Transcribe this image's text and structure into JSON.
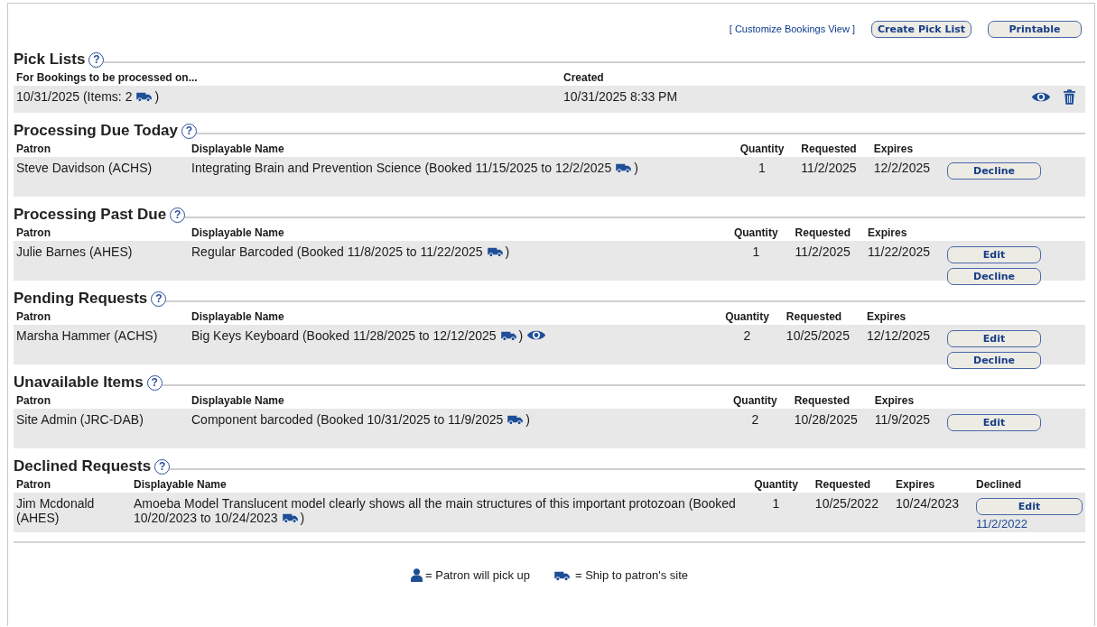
{
  "toolbar": {
    "link": "[ Customize Bookings View ]",
    "buttons": [
      "Create Pick List",
      "Printable"
    ]
  },
  "pick_lists": {
    "title": "Pick Lists",
    "help": "?",
    "columns": [
      "For Bookings to be processed on...",
      "Created"
    ],
    "rows": [
      {
        "date": "10/31/2025 (Items: 2",
        "ship": true,
        "close": ")",
        "created": "10/31/2025 8:33 PM",
        "view": true,
        "delete": true
      }
    ]
  },
  "sections": [
    {
      "title": "Processing Due Today",
      "help": "?",
      "columns": [
        "Patron",
        "Displayable Name",
        "Quantity",
        "Requested",
        "Expires"
      ],
      "rows": [
        {
          "patron": "Steve Davidson (ACHS)",
          "name": [
            "Integrating Brain and Prevention Science (Booked 11/15/2025 to 12/2/2025"
          ],
          "ship": true,
          "close": ")",
          "preview": false,
          "quantity": "1",
          "requested": "11/2/2025",
          "expires": "12/2/2025",
          "actions": [
            "Decline"
          ]
        }
      ]
    },
    {
      "title": "Processing Past Due",
      "help": "?",
      "columns": [
        "Patron",
        "Displayable Name",
        "Quantity",
        "Requested",
        "Expires"
      ],
      "rows": [
        {
          "patron": "Julie Barnes (AHES)",
          "name": [
            "Regular Barcoded (Booked 11/8/2025 to 11/22/2025"
          ],
          "ship": true,
          "close": ")",
          "preview": false,
          "quantity": "1",
          "requested": "11/2/2025",
          "expires": "11/22/2025",
          "actions": [
            "Edit",
            "Decline"
          ]
        }
      ]
    },
    {
      "title": "Pending Requests",
      "help": "?",
      "columns": [
        "Patron",
        "Displayable Name",
        "Quantity",
        "Requested",
        "Expires"
      ],
      "rows": [
        {
          "patron": "Marsha Hammer (ACHS)",
          "name": [
            "Big Keys Keyboard (Booked 11/28/2025 to 12/12/2025"
          ],
          "ship": true,
          "close": ")",
          "preview": true,
          "quantity": "2",
          "requested": "10/25/2025",
          "expires": "12/12/2025",
          "actions": [
            "Edit",
            "Decline"
          ]
        }
      ]
    },
    {
      "title": "Unavailable Items",
      "help": "?",
      "columns": [
        "Patron",
        "Displayable Name",
        "Quantity",
        "Requested",
        "Expires"
      ],
      "rows": [
        {
          "patron": "Site Admin (JRC-DAB)",
          "name": [
            "Component barcoded (Booked 10/31/2025 to 11/9/2025"
          ],
          "ship": true,
          "close": ")",
          "preview": false,
          "quantity": "2",
          "requested": "10/28/2025",
          "expires": "11/9/2025",
          "actions": [
            "Edit"
          ]
        }
      ]
    },
    {
      "title": "Declined Requests",
      "help": "?",
      "columns": [
        "Patron",
        "Displayable Name",
        "Quantity",
        "Requested",
        "Expires",
        "Declined"
      ],
      "rows": [
        {
          "patron": "Jim Mcdonald (AHES)",
          "name": [
            "Amoeba Model Translucent model clearly shows all the main structures of this important protozoan (Booked",
            "10/20/2023 to 10/24/2023"
          ],
          "ship": true,
          "close": ")",
          "preview": false,
          "quantity": "1",
          "requested": "10/25/2022",
          "expires": "10/24/2023",
          "actions": [
            "Edit"
          ],
          "declined": "11/2/2022"
        }
      ]
    }
  ],
  "legend": [
    {
      "kind": "pickup",
      "text": "= Patron will pick up"
    },
    {
      "kind": "ship",
      "text": "= Ship to patron's site"
    }
  ]
}
